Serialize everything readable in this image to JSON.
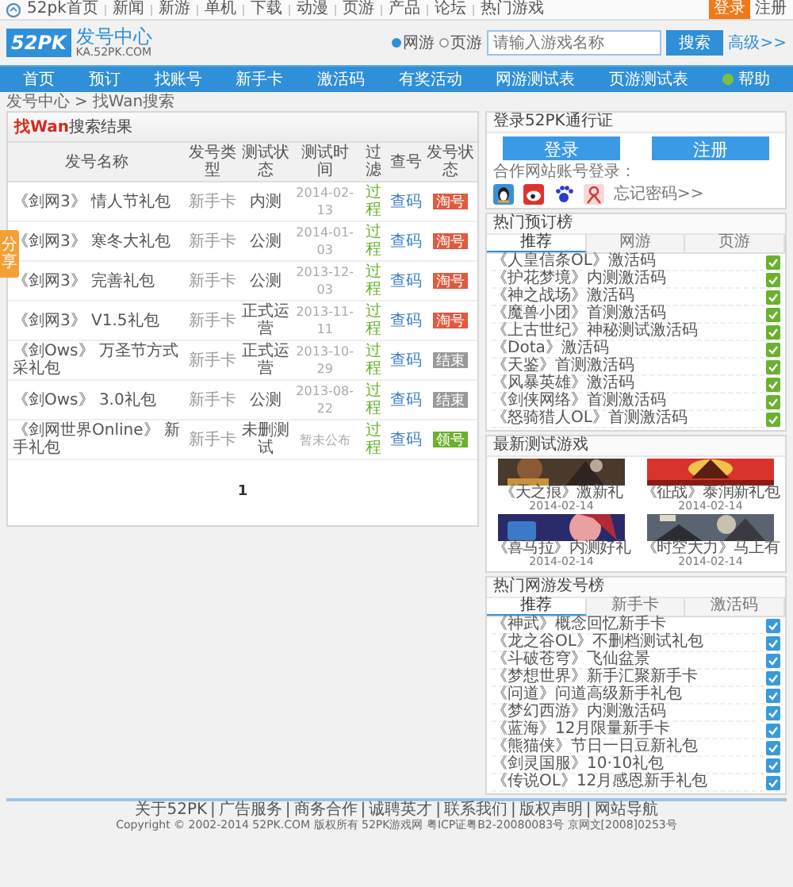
{
  "top_bar": {
    "links": [
      {
        "label": "52pk首页",
        "kind": "home"
      },
      {
        "label": "新闻",
        "kind": "link"
      },
      {
        "label": "新游",
        "kind": "link"
      },
      {
        "label": "单机",
        "kind": "link"
      },
      {
        "label": "下载",
        "kind": "link"
      },
      {
        "label": "动漫",
        "kind": "link"
      },
      {
        "label": "页游",
        "kind": "link"
      },
      {
        "label": "产品",
        "kind": "link"
      },
      {
        "label": "论坛",
        "kind": "link"
      },
      {
        "label": "热门游戏",
        "kind": "link"
      }
    ],
    "login": "登录",
    "register": "注册"
  },
  "header": {
    "logo_mark": "52PK",
    "logo_title": "发号中心",
    "logo_domain": "KA.52PK.COM",
    "search_options": [
      {
        "label": "网游",
        "selected": true
      },
      {
        "label": "页游",
        "selected": false
      }
    ],
    "search": {
      "placeholder": "请输入游戏名称"
    },
    "search_button": "搜索",
    "advanced_link": "高级>>"
  },
  "nav": [
    {
      "label": "首页",
      "kind": "link"
    },
    {
      "label": "预订",
      "kind": "link"
    },
    {
      "label": "找账号",
      "kind": "link"
    },
    {
      "label": "新手卡",
      "kind": "link"
    },
    {
      "label": "激活码",
      "kind": "link"
    },
    {
      "label": "有奖活动",
      "kind": "link"
    },
    {
      "label": "网游测试表",
      "kind": "link"
    },
    {
      "label": "页游测试表",
      "kind": "link"
    },
    {
      "label": "帮助",
      "kind": "help"
    }
  ],
  "breadcrumb": {
    "items": [
      "发号中心",
      "找Wan搜索"
    ],
    "separator": ">"
  },
  "side_tab": {
    "label": "分享"
  },
  "results": {
    "title_highlight": "找Wan",
    "title": "搜索结果",
    "columns": [
      "发号名称",
      "发号类型",
      "测试状态",
      "测试时间",
      "过滤",
      "查号",
      "发号状态"
    ],
    "rows": [
      {
        "name": "《剑网3》 情人节礼包",
        "type": "新手卡",
        "status": "内测",
        "time": "2014-02-13",
        "filter": "过程",
        "lookup": "查码",
        "action": {
          "label": "淘号",
          "kind": "ongoing"
        }
      },
      {
        "name": "《剑网3》 寒冬大礼包",
        "type": "新手卡",
        "status": "公测",
        "time": "2014-01-03",
        "filter": "过程",
        "lookup": "查码",
        "action": {
          "label": "淘号",
          "kind": "ongoing"
        }
      },
      {
        "name": "《剑网3》 完善礼包",
        "type": "新手卡",
        "status": "公测",
        "time": "2013-12-03",
        "filter": "过程",
        "lookup": "查码",
        "action": {
          "label": "淘号",
          "kind": "ongoing"
        }
      },
      {
        "name": "《剑网3》 V1.5礼包",
        "type": "新手卡",
        "status": "正式运营",
        "time": "2013-11-11",
        "filter": "过程",
        "lookup": "查码",
        "action": {
          "label": "淘号",
          "kind": "ongoing"
        }
      },
      {
        "name": "《剑Ows》 万圣节方式采礼包",
        "type": "新手卡",
        "status": "正式运营",
        "time": "2013-10-29",
        "filter": "过程",
        "lookup": "查码",
        "action": {
          "label": "结束",
          "kind": "ended"
        }
      },
      {
        "name": "《剑Ows》 3.0礼包",
        "type": "新手卡",
        "status": "公测",
        "time": "2013-08-22",
        "filter": "过程",
        "lookup": "查码",
        "action": {
          "label": "结束",
          "kind": "ended"
        }
      },
      {
        "name": "《剑网世界Online》 新手礼包",
        "type": "新手卡",
        "status": "未删测试",
        "time": "暂未公布",
        "filter": "过程",
        "lookup": "查码",
        "action": {
          "label": "领号",
          "kind": "available"
        }
      }
    ],
    "pages": [
      {
        "label": "1",
        "selected": true
      }
    ]
  },
  "sidebar": {
    "login": {
      "title": "登录52PK通行证",
      "buttons": [
        "登录",
        "注册"
      ],
      "partner_label": "合作网站账号登录：",
      "partners": [
        {
          "kind": "qq"
        },
        {
          "kind": "weibo"
        },
        {
          "kind": "baidu"
        },
        {
          "kind": "renren"
        }
      ],
      "forgot": "忘记密码>>"
    },
    "hot_reserve": {
      "title": "热门预订榜",
      "tabs": [
        {
          "label": "推荐",
          "selected": true
        },
        {
          "label": "网游",
          "selected": false
        },
        {
          "label": "页游",
          "selected": false
        }
      ],
      "items": [
        "《人皇信条OL》激活码",
        "《护花梦境》内测激活码",
        "《神之战场》激活码",
        "《魔兽小团》首测激活码",
        "《上古世纪》神秘测试激活码",
        "《Dota》激活码",
        "《天鉴》首测激活码",
        "《风暴英雄》激活码",
        "《剑侠网络》首测激活码",
        "《怒骑猎人OL》首测激活码"
      ]
    },
    "new_games": {
      "title": "最新测试游戏",
      "games": [
        {
          "name": "《天之痕》激新礼",
          "date": "2014-02-14"
        },
        {
          "name": "《征战》泰润新礼包",
          "date": "2014-02-14"
        },
        {
          "name": "《喜马拉》内测好礼",
          "date": "2014-02-14"
        },
        {
          "name": "《时空大力》马上有",
          "date": "2014-02-14"
        }
      ]
    },
    "hot_codes": {
      "title": "热门网游发号榜",
      "tabs": [
        {
          "label": "推荐",
          "selected": true
        },
        {
          "label": "新手卡",
          "selected": false
        },
        {
          "label": "激活码",
          "selected": false
        }
      ],
      "items": [
        "《神武》概念回忆新手卡",
        "《龙之谷OL》不删档测试礼包",
        "《斗破苍穹》飞仙盆景",
        "《梦想世界》新手汇聚新手卡",
        "《问道》问道高级新手礼包",
        "《梦幻西游》内测激活码",
        "《蓝海》12月限量新手卡",
        "《熊猫侠》节日一日豆新礼包",
        "《剑灵国服》10·10礼包",
        "《传说OL》12月感恩新手礼包"
      ]
    }
  },
  "footer": {
    "links": [
      "关于52PK",
      "广告服务",
      "商务合作",
      "诚聘英才",
      "联系我们",
      "版权声明",
      "网站导航"
    ],
    "separator": "|",
    "copyright": "Copyright © 2002-2014 52PK.COM 版权所有 52PK游戏网 粤ICP证粤B2-20080083号 京网文[2008]0253号"
  }
}
